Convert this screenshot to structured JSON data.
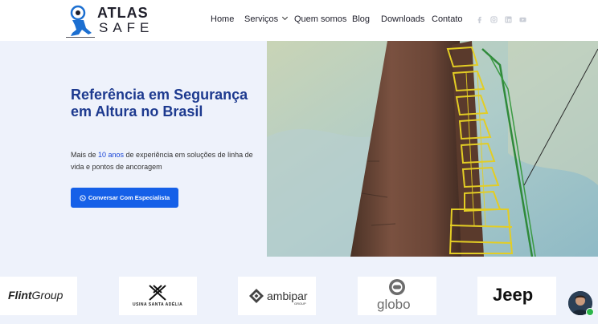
{
  "brand": {
    "line1": "ATLAS",
    "line2": "SAFE"
  },
  "nav": {
    "items": [
      "Home",
      "Serviços",
      "Quem somos",
      "Blog",
      "Downloads",
      "Contato"
    ]
  },
  "social": [
    "facebook-icon",
    "instagram-icon",
    "linkedin-icon",
    "youtube-icon"
  ],
  "hero": {
    "title": "Referência em Segurança em Altura no Brasil",
    "sub_before": "Mais de ",
    "sub_highlight": "10 anos",
    "sub_after": " de experiência em soluções de linha de vida e pontos de ancoragem",
    "cta_label": "Conversar Com Especialista"
  },
  "partners": {
    "flint_1": "Flint",
    "flint_2": "Group",
    "usina": "USINA SANTA ADÉLIA",
    "ambipar": "ambipar",
    "ambipar_sub": "GROUP",
    "globo": "globo",
    "jeep": "Jeep"
  },
  "colors": {
    "accent": "#1560e8",
    "title": "#1d3a8f",
    "hero_bg": "#eef2fb"
  }
}
